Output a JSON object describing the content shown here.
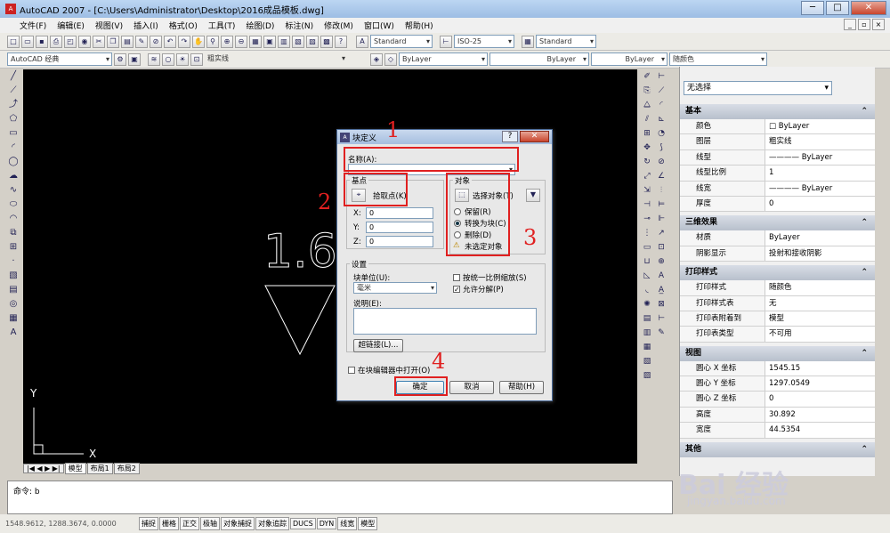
{
  "window": {
    "title": "AutoCAD 2007 - [C:\\Users\\Administrator\\Desktop\\2016成品模板.dwg]",
    "min": "─",
    "max": "□",
    "close": "✕"
  },
  "menu": [
    "文件(F)",
    "编辑(E)",
    "视图(V)",
    "插入(I)",
    "格式(O)",
    "工具(T)",
    "绘图(D)",
    "标注(N)",
    "修改(M)",
    "窗口(W)",
    "帮助(H)"
  ],
  "toolbar": {
    "text_style": "Standard",
    "dim_style": "ISO-25",
    "table_style": "Standard",
    "workspace": "AutoCAD 经典",
    "linetype_name": "粗实线",
    "layer1": "ByLayer",
    "layer2": "ByLayer",
    "layer3": "ByLayer",
    "color": "随颜色"
  },
  "canvas": {
    "text": "1.6",
    "y_axis": "Y",
    "x_axis": "X"
  },
  "sheet_tabs": [
    "模型",
    "布局1",
    "布局2"
  ],
  "props": {
    "selection": "无选择",
    "sections": [
      {
        "title": "基本",
        "rows": [
          [
            "颜色",
            "□ ByLayer"
          ],
          [
            "图层",
            "粗实线"
          ],
          [
            "线型",
            "———— ByLayer"
          ],
          [
            "线型比例",
            "1"
          ],
          [
            "线宽",
            "———— ByLayer"
          ],
          [
            "厚度",
            "0"
          ]
        ]
      },
      {
        "title": "三维效果",
        "rows": [
          [
            "材质",
            "ByLayer"
          ],
          [
            "阴影显示",
            "投射和接收阴影"
          ]
        ]
      },
      {
        "title": "打印样式",
        "rows": [
          [
            "打印样式",
            "随颜色"
          ],
          [
            "打印样式表",
            "无"
          ],
          [
            "打印表附着到",
            "模型"
          ],
          [
            "打印表类型",
            "不可用"
          ]
        ]
      },
      {
        "title": "视图",
        "rows": [
          [
            "圆心 X 坐标",
            "1545.15"
          ],
          [
            "圆心 Y 坐标",
            "1297.0549"
          ],
          [
            "圆心 Z 坐标",
            "0"
          ],
          [
            "高度",
            "30.892"
          ],
          [
            "宽度",
            "44.5354"
          ]
        ]
      },
      {
        "title": "其他",
        "rows": []
      }
    ]
  },
  "command": {
    "prompt": "命令: b"
  },
  "status": {
    "coords": "1548.9612, 1288.3674, 0.0000",
    "buttons": [
      "捕捉",
      "栅格",
      "正交",
      "极轴",
      "对象捕捉",
      "对象追踪",
      "DUCS",
      "DYN",
      "线宽",
      "模型"
    ]
  },
  "dialog": {
    "title": "块定义",
    "help": "?",
    "close": "✕",
    "name_label": "名称(A):",
    "name_value": "",
    "base_label": "基点",
    "pick_point": "拾取点(K)",
    "x_label": "X:",
    "y_label": "Y:",
    "z_label": "Z:",
    "x": "0",
    "y": "0",
    "z": "0",
    "objects_label": "对象",
    "select_objects": "选择对象(T)",
    "retain": "保留(R)",
    "convert": "转换为块(C)",
    "delete": "删除(D)",
    "warning": "未选定对象",
    "settings_label": "设置",
    "unit_label": "块单位(U):",
    "unit_value": "毫米",
    "uniform_scale": "按统一比例缩放(S)",
    "allow_explode": "允许分解(P)",
    "desc_label": "说明(E):",
    "desc_value": "",
    "hyperlink": "超链接(L)...",
    "open_editor": "在块编辑器中打开(O)",
    "ok": "确定",
    "cancel": "取消",
    "help_btn": "帮助(H)"
  },
  "annotations": [
    "1",
    "2",
    "3",
    "4"
  ],
  "watermark": {
    "brand": "Bai 经验",
    "url": "jingyan.baidu.com"
  }
}
